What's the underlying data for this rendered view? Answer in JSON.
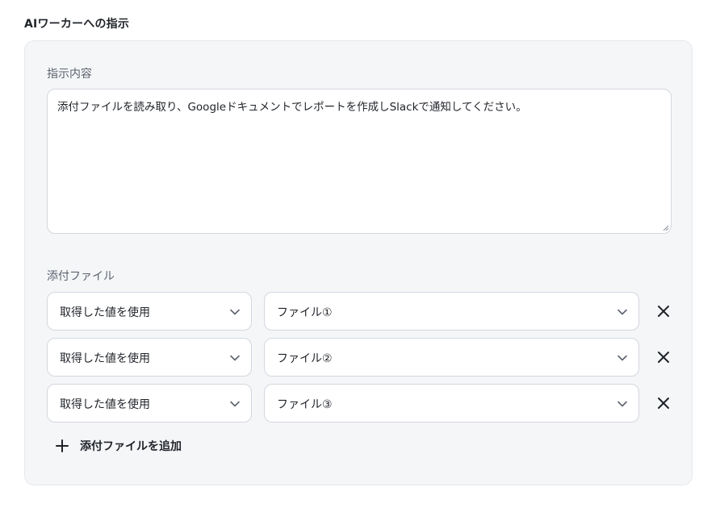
{
  "section": {
    "title": "AIワーカーへの指示"
  },
  "instruction": {
    "label": "指示内容",
    "value": "添付ファイルを読み取り、Googleドキュメントでレポートを作成しSlackで通知してください。"
  },
  "attachments": {
    "label": "添付ファイル",
    "rows": [
      {
        "source": "取得した値を使用",
        "file": "ファイル①"
      },
      {
        "source": "取得した値を使用",
        "file": "ファイル②"
      },
      {
        "source": "取得した値を使用",
        "file": "ファイル③"
      }
    ],
    "add_label": "添付ファイルを追加"
  },
  "icons": {
    "chevron": "chevron-down-icon",
    "remove": "close-icon",
    "add": "plus-icon"
  },
  "colors": {
    "panel_background": "#f5f6f8",
    "border": "#d3d7dd",
    "text": "#1f2329",
    "muted_text": "#5c636e"
  }
}
